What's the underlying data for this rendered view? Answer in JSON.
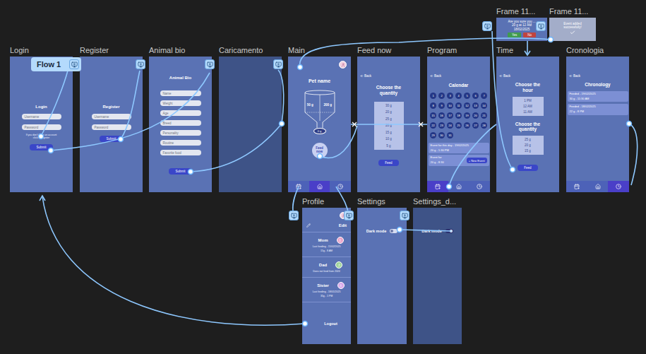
{
  "canvas": {
    "flow": "Flow 1"
  },
  "login": {
    "label": "Login",
    "title": "Login",
    "fields": [
      "Username",
      "Password"
    ],
    "hint": "If you don't have an account click to register",
    "button": "Submit"
  },
  "register": {
    "label": "Register",
    "title": "Register",
    "fields": [
      "Username",
      "Password"
    ],
    "button": "Submit"
  },
  "animal_bio": {
    "label": "Animal bio",
    "title": "Animal Bio",
    "fields": [
      "Name",
      "Weight",
      "Age",
      "Breed",
      "Personality",
      "Routine",
      "Favorite food"
    ],
    "button": "Submit"
  },
  "loading": {
    "label": "Caricamento"
  },
  "main": {
    "label": "Main",
    "pet_name": "Pet name",
    "levels": [
      "50 g",
      "200 g"
    ],
    "bowl": "0 g",
    "feed_button": "Feed now",
    "nav": [
      {
        "selected": false
      },
      {
        "selected": true
      },
      {
        "selected": false
      }
    ]
  },
  "feed_now": {
    "label": "Feed now",
    "back": "Back",
    "title": "Choose the quantity",
    "quantities": [
      "30 g",
      "20 g",
      "25 g",
      "20 g",
      "15 g",
      "10 g",
      "5 g"
    ],
    "button": "Feed"
  },
  "program": {
    "label": "Program",
    "back": "Back",
    "title": "Calendar",
    "days": [
      "1",
      "2",
      "3",
      "4",
      "5",
      "6",
      "7",
      "8",
      "9",
      "10",
      "11",
      "12",
      "13",
      "14",
      "15",
      "16",
      "17",
      "18",
      "19",
      "20",
      "21",
      "22",
      "23",
      "24",
      "25",
      "26",
      "27",
      "28",
      "29",
      "30",
      "31"
    ],
    "events": [
      {
        "title": "Event for this day - 19/02/2025",
        "detail": "20 g - 1:30 PM"
      },
      {
        "title": "Event for",
        "detail": "20 g - 8:30"
      }
    ],
    "new_event": "+ New Event",
    "nav": [
      {
        "selected": true
      },
      {
        "selected": false
      },
      {
        "selected": false
      }
    ]
  },
  "time": {
    "label": "Time",
    "back": "Back",
    "hour_title": "Choose the hour",
    "hours": [
      "1 PM",
      "12 AM",
      "11 AM"
    ],
    "quantity_title": "Choose the quantity",
    "quantities": [
      "25 g",
      "20 g",
      "15 g"
    ],
    "button": "Feed"
  },
  "chronology": {
    "label": "Cronologia",
    "back": "Back",
    "title": "Chronology",
    "entries": [
      {
        "title": "Feeded - 19/02/2025",
        "detail": "30 g - 11:30 AM"
      },
      {
        "title": "Feeded - 18/02/2025",
        "detail": "22 g - 8 PM"
      }
    ],
    "nav": [
      {
        "selected": false
      },
      {
        "selected": false
      },
      {
        "selected": true
      }
    ]
  },
  "profile": {
    "label": "Profile",
    "edit": "Edit",
    "members": [
      {
        "name": "Mom",
        "lines": [
          "Last feeding - 15/02/2025",
          "15g - 8 AM"
        ],
        "color": "#eaa3c9"
      },
      {
        "name": "Dad",
        "lines": [
          "Does not feed from 2024"
        ],
        "color": "#9fd49a"
      },
      {
        "name": "Sister",
        "lines": [
          "Last feeding - 18/01/2025",
          "35g - 1 PM"
        ],
        "color": "#d9a9ea"
      }
    ],
    "logout": "Logout"
  },
  "settings": {
    "label": "Settings",
    "option": "Dark mode",
    "on": false
  },
  "settings_dark": {
    "label": "Settings_d...",
    "option": "Dark mode",
    "on": true
  },
  "confirm_popup": {
    "label": "Frame 11...",
    "lines": [
      "Are you sure you ...",
      "20 g at 12 AM",
      "18/02/2025"
    ],
    "buttons": [
      {
        "label": "Yes",
        "color": "#3f9b4f"
      },
      {
        "label": "No",
        "color": "#c0443f"
      }
    ]
  },
  "success_popup": {
    "label": "Frame 11...",
    "message": "Event added successfully!"
  }
}
